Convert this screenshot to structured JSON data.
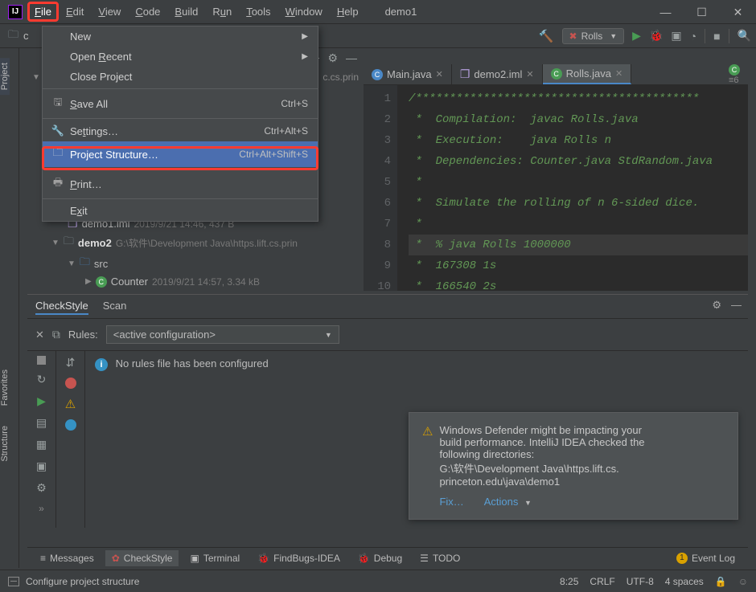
{
  "titlebar": {
    "menus": [
      "File",
      "Edit",
      "View",
      "Code",
      "Build",
      "Run",
      "Tools",
      "Window",
      "Help"
    ],
    "title": "demo1"
  },
  "window_controls": {
    "min": "—",
    "max": "☐",
    "close": "✕"
  },
  "toolbar": {
    "run_config": "Rolls"
  },
  "file_menu": {
    "new": "New",
    "open_recent": "Open Recent",
    "close_project": "Close Project",
    "save_all": "Save All",
    "save_all_kbd": "Ctrl+S",
    "settings": "Settings…",
    "settings_kbd": "Ctrl+Alt+S",
    "project_structure": "Project Structure…",
    "project_structure_kbd": "Ctrl+Alt+Shift+S",
    "print": "Print…",
    "exit": "Exit"
  },
  "editor_tabs": {
    "t1": "Main.java",
    "t2": "demo2.iml",
    "t3": "Rolls.java",
    "overflow": "≡6"
  },
  "code": {
    "l1": "/******************************************",
    "l2": " *  Compilation:  javac Rolls.java",
    "l3": " *  Execution:    java Rolls n",
    "l4": " *  Dependencies: Counter.java StdRandom.java",
    "l5": " *",
    "l6": " *  Simulate the rolling of n 6-sided dice.",
    "l7": " *",
    "l8": " *  % java Rolls 1000000",
    "l9": " *  167308 1s",
    "l10": " *  166540 2s"
  },
  "gutter": {
    "n1": "1",
    "n2": "2",
    "n3": "3",
    "n4": "4",
    "n5": "5",
    "n6": "6",
    "n7": "7",
    "n8": "8",
    "n9": "9",
    "n10": "10"
  },
  "proj_tree": {
    "row1": "demo1.iml",
    "row1_meta": "2019/9/21 14:46, 437 B",
    "row2": "demo2",
    "row2_meta": "G:\\软件\\Development Java\\https.lift.cs.prin",
    "row3": "src",
    "row4": "Counter",
    "row4_meta": "2019/9/21 14:57, 3.34 kB",
    "crumb": "c.cs.prin"
  },
  "tool_window": {
    "tab1": "CheckStyle",
    "tab2": "Scan",
    "rules_label": "Rules:",
    "rules_value": "<active configuration>",
    "no_rules": "No rules file has been configured"
  },
  "notification": {
    "line1": "Windows Defender might be impacting your",
    "line2": "build performance. IntelliJ IDEA checked the",
    "line3": "following directories:",
    "line4": "G:\\软件\\Development Java\\https.lift.cs.",
    "line5": "princeton.edu\\java\\demo1",
    "fix": "Fix…",
    "actions": "Actions"
  },
  "bottom_tabs": {
    "messages": "Messages",
    "checkstyle": "CheckStyle",
    "terminal": "Terminal",
    "findbugs": "FindBugs-IDEA",
    "debug": "Debug",
    "todo": "TODO",
    "eventlog": "Event Log"
  },
  "statusbar": {
    "msg": "Configure project structure",
    "pos": "8:25",
    "eol": "CRLF",
    "enc": "UTF-8",
    "indent": "4 spaces"
  },
  "left_tabs": {
    "project": "Project",
    "favorites": "Favorites",
    "structure": "Structure"
  }
}
